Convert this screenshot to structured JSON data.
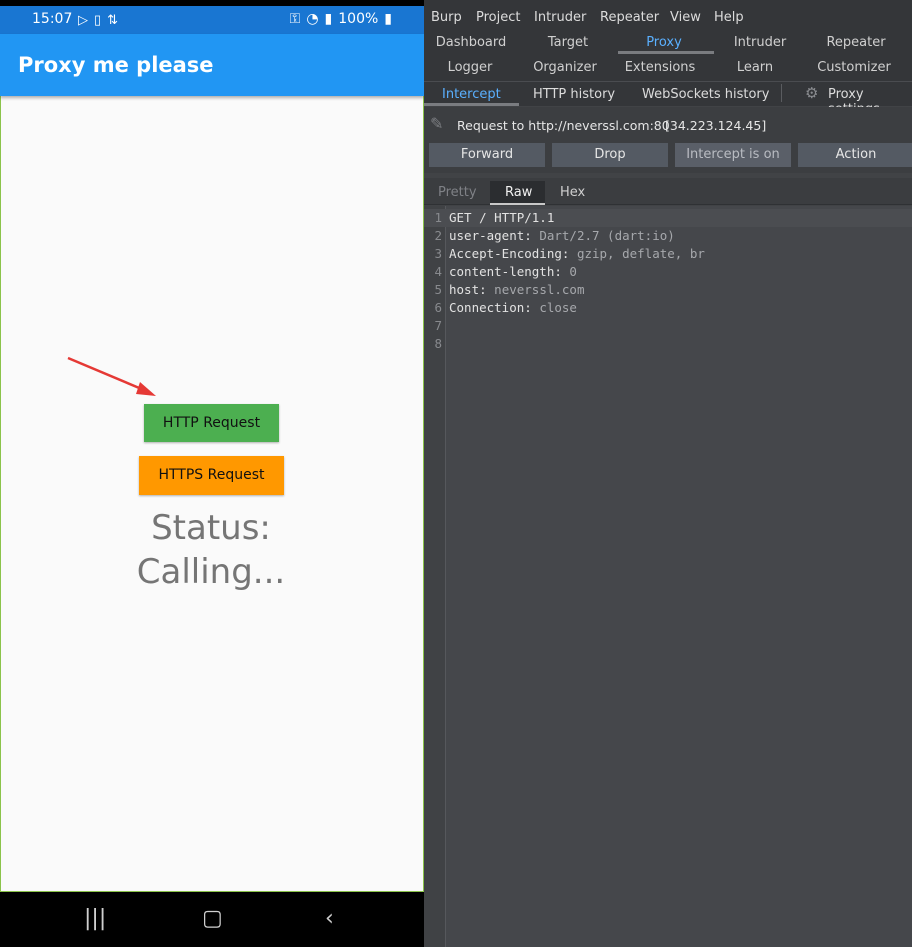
{
  "phone": {
    "status_bar": {
      "time": "15:07",
      "battery": "100%",
      "icons": [
        "play-icon",
        "sim-icon",
        "signal-toggle-icon",
        "key-icon",
        "wifi-icon",
        "cell-signal-icon",
        "battery-icon"
      ]
    },
    "app_title": "Proxy me please",
    "http_button": "HTTP Request",
    "https_button": "HTTPS Request",
    "status_line1": "Status:",
    "status_line2": "Calling...",
    "colors": {
      "app_bar": "#2196f3",
      "status_bar": "#1976d2",
      "http_button": "#4caf50",
      "https_button": "#ff9800",
      "arrow": "#e53935"
    },
    "nav": [
      "recent-apps-icon",
      "home-icon",
      "back-icon"
    ]
  },
  "burp": {
    "menu": [
      "Burp",
      "Project",
      "Intruder",
      "Repeater",
      "View",
      "Help"
    ],
    "tabs_row1": [
      "Dashboard",
      "Target",
      "Proxy",
      "Intruder",
      "Repeater"
    ],
    "tabs_row2": [
      "Logger",
      "Organizer",
      "Extensions",
      "Learn",
      "Customizer"
    ],
    "active_tab": "Proxy",
    "subtabs": [
      "Intercept",
      "HTTP history",
      "WebSockets history"
    ],
    "active_subtab": "Intercept",
    "proxy_settings": "Proxy settings",
    "request_label": "Request to http://neverssl.com:80",
    "request_ip": "[34.223.124.45]",
    "toolbar": {
      "forward": "Forward",
      "drop": "Drop",
      "intercept": "Intercept is on",
      "action": "Action"
    },
    "view_tabs": [
      "Pretty",
      "Raw",
      "Hex"
    ],
    "active_view": "Raw",
    "request_lines": [
      {
        "num": "1",
        "key": "GET / HTTP/1.1",
        "value": ""
      },
      {
        "num": "2",
        "key": "user-agent",
        "value": "Dart/2.7 (dart:io)"
      },
      {
        "num": "3",
        "key": "Accept-Encoding",
        "value": "gzip, deflate, br"
      },
      {
        "num": "4",
        "key": "content-length",
        "value": "0"
      },
      {
        "num": "5",
        "key": "host",
        "value": "neverssl.com"
      },
      {
        "num": "6",
        "key": "Connection",
        "value": "close"
      },
      {
        "num": "7",
        "key": "",
        "value": ""
      },
      {
        "num": "8",
        "key": "",
        "value": ""
      }
    ],
    "colors": {
      "background": "#414346",
      "active_tab": "#5ab0ff"
    }
  }
}
